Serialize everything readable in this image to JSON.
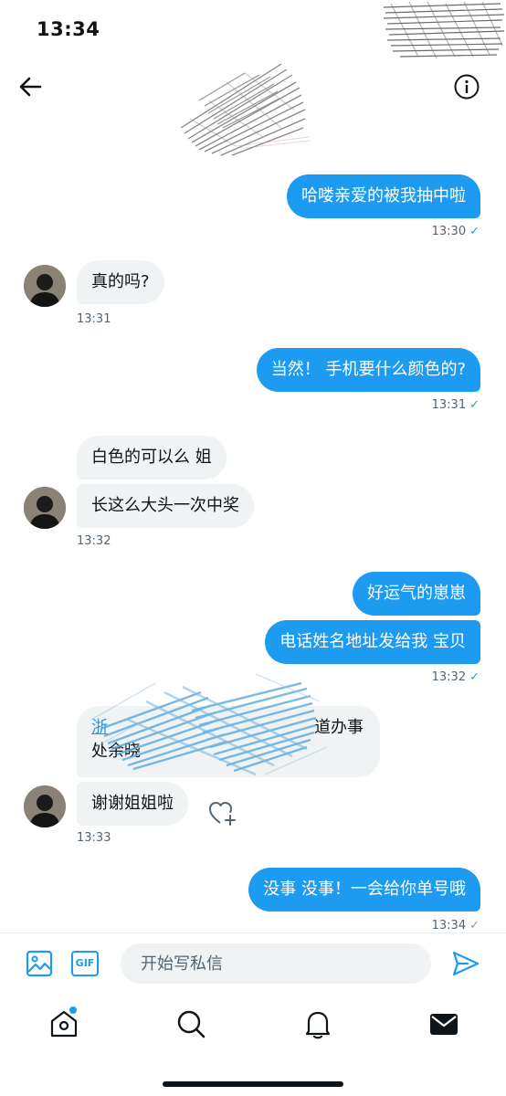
{
  "status_bar": {
    "time": "13:34"
  },
  "header": {
    "back_icon": "arrow-left-icon",
    "info_icon": "info-circle-icon"
  },
  "messages": [
    {
      "dir": "out",
      "text": "哈喽亲爱的被我抽中啦",
      "time": "13:30",
      "status": "✓"
    },
    {
      "dir": "in",
      "text": "真的吗?",
      "time": "13:31"
    },
    {
      "dir": "out",
      "text": "当然！ 手机要什么颜色的?",
      "time": "13:31",
      "status": "✓"
    },
    {
      "dir": "in",
      "text": "白色的可以么 姐"
    },
    {
      "dir": "in",
      "text": "长这么大头一次中奖",
      "time": "13:32"
    },
    {
      "dir": "out",
      "text": "好运气的崽崽"
    },
    {
      "dir": "out",
      "text": "电话姓名地址发给我 宝贝",
      "time": "13:32",
      "status": "✓"
    },
    {
      "dir": "in",
      "text_line1_start": "浙",
      "text_line1_end": "道办事",
      "text_line2_start": "处余晓",
      "redacted": true
    },
    {
      "dir": "in",
      "text": "谢谢姐姐啦",
      "time": "13:33",
      "reaction_icon": "heart-add-icon"
    },
    {
      "dir": "out",
      "text": "没事 没事！一会给你单号哦",
      "time": "13:34",
      "status": "✓"
    }
  ],
  "composer": {
    "image_icon": "image-icon",
    "gif_label": "GIF",
    "placeholder": "开始写私信",
    "send_icon": "send-icon"
  },
  "tab_bar": {
    "items": [
      "home-icon",
      "search-icon",
      "notifications-icon",
      "messages-icon"
    ],
    "active": "messages-icon",
    "home_badge_color": "#1d9bf0"
  },
  "colors": {
    "accent": "#1d9bf0",
    "incoming_bubble": "#eff3f4",
    "text": "#0f1419",
    "muted": "#536471"
  }
}
